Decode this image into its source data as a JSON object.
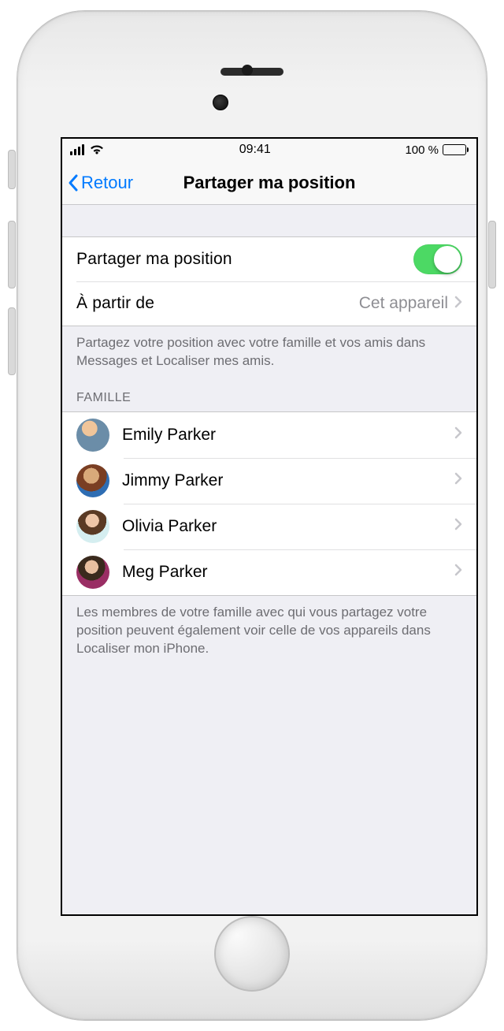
{
  "status": {
    "time": "09:41",
    "battery": "100 %"
  },
  "nav": {
    "back": "Retour",
    "title": "Partager ma position"
  },
  "share": {
    "toggle_label": "Partager ma position",
    "from_label": "À partir de",
    "from_value": "Cet appareil",
    "footer": "Partagez votre position avec votre famille et vos amis dans Messages et Localiser mes amis."
  },
  "family": {
    "header": "FAMILLE",
    "members": [
      {
        "name": "Emily Parker"
      },
      {
        "name": "Jimmy Parker"
      },
      {
        "name": "Olivia Parker"
      },
      {
        "name": "Meg Parker"
      }
    ],
    "footer": "Les membres de votre famille avec qui vous partagez votre position peuvent également voir celle de vos appareils dans Localiser mon iPhone."
  }
}
